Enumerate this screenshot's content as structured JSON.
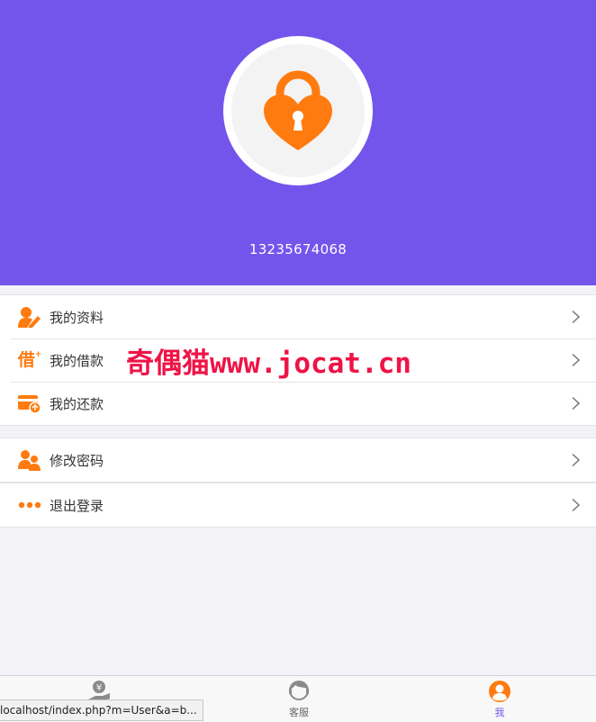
{
  "profile": {
    "avatar_icon": "heart-lock-icon",
    "phone": "13235674068"
  },
  "menu_group_1": [
    {
      "icon": "user-edit-icon",
      "label": "我的资料"
    },
    {
      "icon": "borrow-icon",
      "icon_text": "借",
      "label": "我的借款"
    },
    {
      "icon": "card-repay-icon",
      "label": "我的还款"
    }
  ],
  "menu_group_2": [
    {
      "icon": "users-icon",
      "label": "修改密码"
    }
  ],
  "menu_group_3": [
    {
      "icon": "more-dots-icon",
      "label": "退出登录"
    }
  ],
  "watermark": "奇偶猫www.jocat.cn",
  "tabbar": {
    "tabs": [
      {
        "icon": "yuan-hand-icon",
        "label": ""
      },
      {
        "icon": "customer-service-icon",
        "label": "客服"
      },
      {
        "icon": "me-icon",
        "label": "我",
        "active": true
      }
    ]
  },
  "status_url": "localhost/index.php?m=User&a=b...",
  "colors": {
    "header": "#7455eb",
    "accent": "#ff7b0f",
    "watermark": "#ee1346"
  }
}
